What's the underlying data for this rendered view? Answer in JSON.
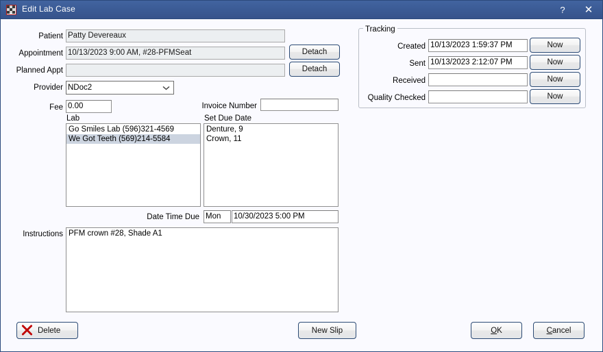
{
  "window": {
    "title": "Edit Lab Case",
    "app_icon": "grid-icon",
    "help_label": "?",
    "close_label": "✕"
  },
  "form": {
    "patient_label": "Patient",
    "patient_value": "Patty Devereaux",
    "appointment_label": "Appointment",
    "appointment_value": "10/13/2023 9:00 AM, #28-PFMSeat",
    "planned_appt_label": "Planned Appt",
    "planned_appt_value": "",
    "detach_appointment_label": "Detach",
    "detach_planned_label": "Detach",
    "provider_label": "Provider",
    "provider_value": "NDoc2",
    "fee_label": "Fee",
    "fee_value": "0.00",
    "invoice_label": "Invoice Number",
    "invoice_value": "",
    "lab_label": "Lab",
    "lab_items": [
      {
        "text": "Go Smiles Lab (596)321-4569",
        "selected": false
      },
      {
        "text": "We Got Teeth (569)214-5584",
        "selected": true
      }
    ],
    "due_date_label": "Set Due Date",
    "due_date_items": [
      "Denture, 9",
      "Crown, 11"
    ],
    "date_time_due_label": "Date Time Due",
    "date_time_due_day": "Mon",
    "date_time_due_value": "10/30/2023 5:00 PM",
    "instructions_label": "Instructions",
    "instructions_value": "PFM crown #28, Shade A1"
  },
  "tracking": {
    "legend": "Tracking",
    "rows": [
      {
        "label": "Created",
        "value": "10/13/2023 1:59:37 PM",
        "button": "Now"
      },
      {
        "label": "Sent",
        "value": "10/13/2023 2:12:07 PM",
        "button": "Now"
      },
      {
        "label": "Received",
        "value": "",
        "button": "Now"
      },
      {
        "label": "Quality Checked",
        "value": "",
        "button": "Now"
      }
    ]
  },
  "footer": {
    "delete_label": "Delete",
    "delete_icon": "red-x-icon",
    "new_slip_label": "New Slip",
    "ok_label": "OK",
    "ok_accel": "O",
    "cancel_label": "Cancel",
    "cancel_accel": "C"
  },
  "colors": {
    "titlebar": "#3b5b95",
    "body": "#fafaff",
    "selection": "#ccd4e0",
    "button_border": "#2b4a74",
    "delete_x": "#c00000"
  }
}
